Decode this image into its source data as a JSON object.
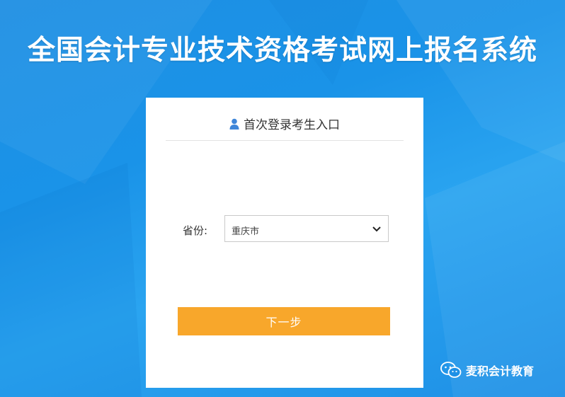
{
  "page": {
    "title": "全国会计专业技术资格考试网上报名系统"
  },
  "login_card": {
    "header": "首次登录考生入口",
    "province_label": "省份:",
    "province_value": "重庆市",
    "next_button": "下一步"
  },
  "watermark": {
    "text": "麦积会计教育"
  },
  "colors": {
    "background": "#1a93e8",
    "button": "#f8a72b",
    "card": "#ffffff"
  },
  "icons": {
    "header": "user-icon",
    "select": "chevron-down-icon",
    "watermark": "wechat-icon"
  }
}
